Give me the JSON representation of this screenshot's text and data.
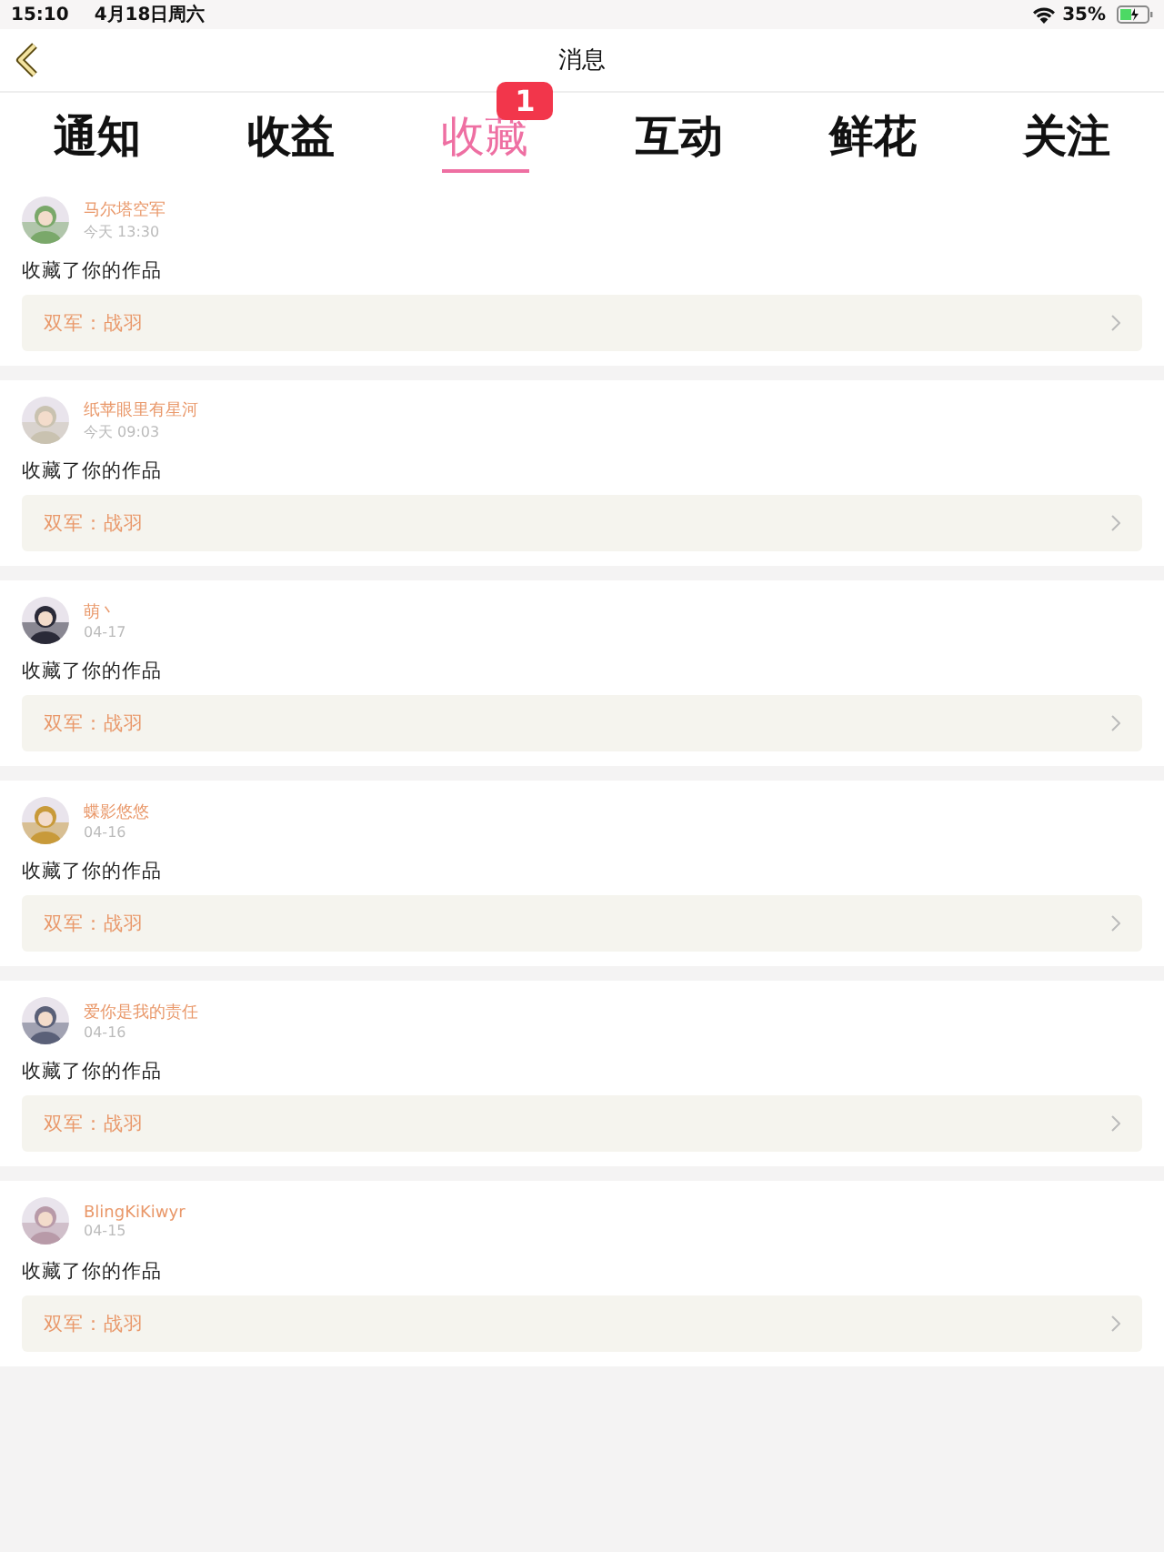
{
  "status_bar": {
    "time": "15:10",
    "date": "4月18日周六",
    "battery": "35%"
  },
  "nav": {
    "title": "消息"
  },
  "tabs": [
    {
      "label": "通知",
      "selected": false
    },
    {
      "label": "收益",
      "selected": false
    },
    {
      "label": "收藏",
      "selected": true,
      "badge": "1"
    },
    {
      "label": "互动",
      "selected": false
    },
    {
      "label": "鲜花",
      "selected": false
    },
    {
      "label": "关注",
      "selected": false
    }
  ],
  "messages": [
    {
      "user": "马尔塔空军",
      "time": "今天 13:30",
      "text": "收藏了你的作品",
      "work": "双军：战羽"
    },
    {
      "user": "纸苹眼里有星河",
      "time": "今天 09:03",
      "text": "收藏了你的作品",
      "work": "双军：战羽"
    },
    {
      "user": "萌丶",
      "time": "04-17",
      "text": "收藏了你的作品",
      "work": "双军：战羽"
    },
    {
      "user": "蝶影悠悠",
      "time": "04-16",
      "text": "收藏了你的作品",
      "work": "双军：战羽"
    },
    {
      "user": "爱你是我的责任",
      "time": "04-16",
      "text": "收藏了你的作品",
      "work": "双军：战羽"
    },
    {
      "user": "BlingKiKiwyr",
      "time": "04-15",
      "text": "收藏了你的作品",
      "work": "双军：战羽"
    }
  ]
}
